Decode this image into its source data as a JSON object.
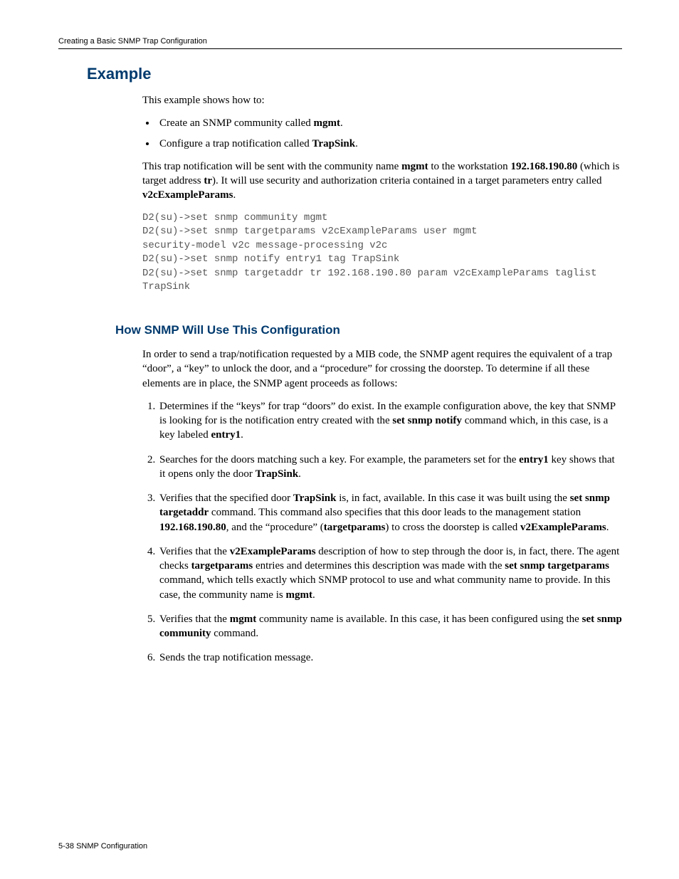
{
  "running_head": "Creating a Basic SNMP Trap Configuration",
  "h1": "Example",
  "intro": "This example shows how to:",
  "bullets": {
    "b1_pre": "Create an SNMP community called ",
    "b1_bold": "mgmt",
    "b1_post": ".",
    "b2_pre": "Configure a trap notification called ",
    "b2_bold": "TrapSink",
    "b2_post": "."
  },
  "para2": {
    "t1": "This trap notification will be sent with the community name ",
    "b1": "mgmt",
    "t2": " to the workstation ",
    "b2": "192.168.190.80",
    "t3": " (which is target address ",
    "b3": "tr",
    "t4": "). It will use security and authorization criteria contained in a target parameters entry called ",
    "b4": "v2cExampleParams",
    "t5": "."
  },
  "code": "D2(su)->set snmp community mgmt\nD2(su)->set snmp targetparams v2cExampleParams user mgmt\nsecurity-model v2c message-processing v2c\nD2(su)->set snmp notify entry1 tag TrapSink\nD2(su)->set snmp targetaddr tr 192.168.190.80 param v2cExampleParams taglist\nTrapSink",
  "h2": "How SNMP Will Use This Configuration",
  "para3": "In order to send a trap/notification requested by a MIB code, the SNMP agent requires the equivalent of a trap “door”, a “key” to unlock the door, and a “procedure” for crossing the doorstep. To determine if all these elements are in place, the SNMP agent proceeds as follows:",
  "steps": {
    "s1": {
      "t1": "Determines if the “keys” for trap “doors” do exist. In the example configuration above, the key that SNMP is looking for is the notification entry created with the ",
      "b1": "set snmp notify",
      "t2": " command which, in this case, is a key labeled ",
      "b2": "entry1",
      "t3": "."
    },
    "s2": {
      "t1": "Searches for the doors matching such a key. For example, the parameters set for the ",
      "b1": "entry1",
      "t2": " key shows that it opens only the door ",
      "b2": "TrapSink",
      "t3": "."
    },
    "s3": {
      "t1": "Verifies that the specified door ",
      "b1": "TrapSink",
      "t2": " is, in fact, available. In this case it was built using the ",
      "b2": "set snmp targetaddr",
      "t3": " command. This command also specifies that this door leads to the management station ",
      "b3": "192.168.190.80",
      "t4": ", and the “procedure” (",
      "b4": "targetparams",
      "t5": ") to cross the doorstep is called ",
      "b5": "v2ExampleParams",
      "t6": "."
    },
    "s4": {
      "t1": "Verifies that the ",
      "b1": "v2ExampleParams",
      "t2": " description of how to step through the door is, in fact, there. The agent checks ",
      "b2": "targetparams",
      "t3": " entries and determines this description was made with the ",
      "b3": "set snmp targetparams",
      "t4": " command, which tells exactly which SNMP protocol to use and what community name to provide. In this case, the community name is ",
      "b4": "mgmt",
      "t5": "."
    },
    "s5": {
      "t1": "Verifies that the ",
      "b1": "mgmt",
      "t2": " community name is available. In this case, it has been configured using the ",
      "b2": "set snmp community",
      "t3": " command."
    },
    "s6": {
      "t1": "Sends the trap notification message."
    }
  },
  "footer": {
    "page": "5-38",
    "sep": "   ",
    "title": "SNMP Configuration"
  }
}
